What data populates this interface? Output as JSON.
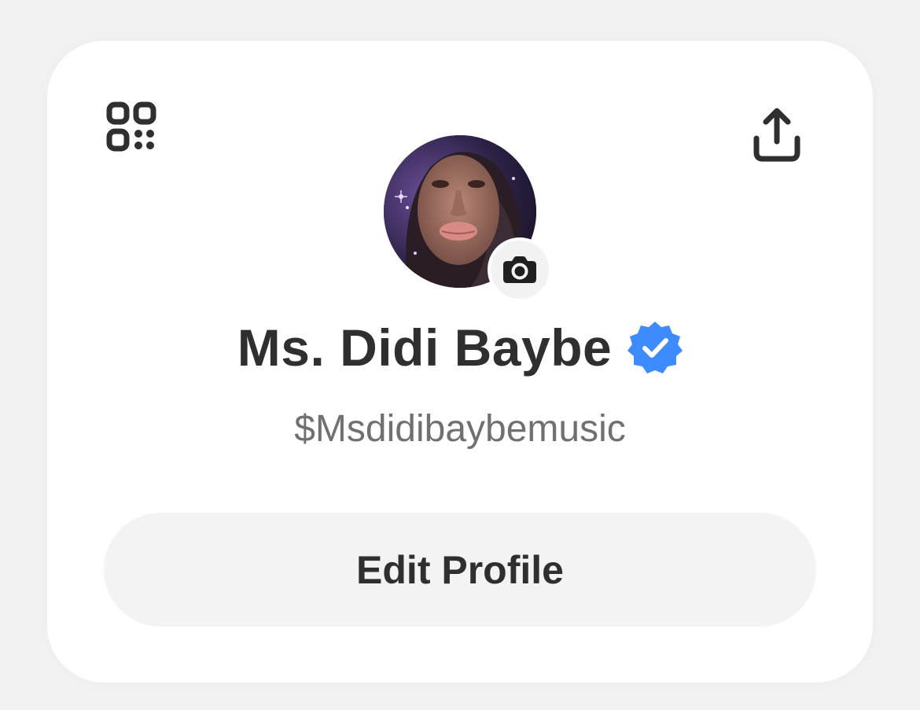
{
  "profile": {
    "display_name": "Ms. Didi Baybe",
    "cashtag": "$Msdidibaybemusic",
    "verified": true,
    "avatar_alt": "Profile photo"
  },
  "actions": {
    "edit_profile_label": "Edit Profile"
  },
  "icons": {
    "qr": "qr-code-icon",
    "share": "share-icon",
    "camera": "camera-icon",
    "verified": "verified-badge-icon"
  },
  "colors": {
    "background": "#f2f2f2",
    "card": "#ffffff",
    "text_primary": "#2f2f2f",
    "text_secondary": "#707070",
    "button_bg": "#f3f3f3",
    "verified_blue": "#3d8bff"
  }
}
